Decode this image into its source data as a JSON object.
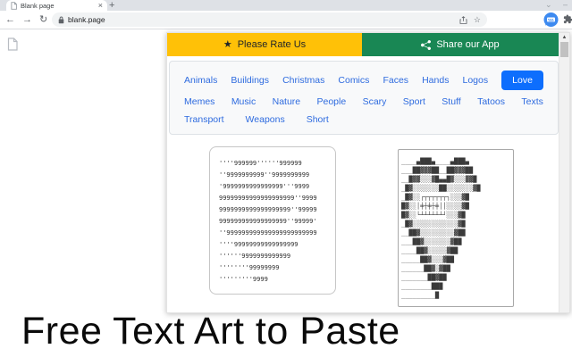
{
  "browser": {
    "tab": {
      "title": "Blank page",
      "close_icon": "×"
    },
    "new_tab_icon": "+",
    "window_controls": {
      "chevron_icon": "⌄",
      "minimize_icon": "–"
    },
    "nav": {
      "back_icon": "←",
      "forward_icon": "→",
      "reload_icon": "↻"
    },
    "omnibox": {
      "url": "blank.page"
    },
    "bookmark_icon": "☆"
  },
  "page": {
    "heading": "Free Text Art to Paste"
  },
  "popup": {
    "banner": {
      "rate_icon": "★",
      "rate_label": "Please Rate Us",
      "share_label": "Share our App"
    },
    "categories": {
      "row1": [
        "Animals",
        "Buildings",
        "Christmas",
        "Comics",
        "Faces",
        "Hands",
        "Logos"
      ],
      "active": "Love",
      "row2": [
        "Memes",
        "Music",
        "Nature",
        "People",
        "Scary",
        "Sport",
        "Stuff",
        "Tatoos",
        "Texts"
      ],
      "row3": [
        "Transport",
        "Weapons",
        "Short"
      ]
    },
    "arts": {
      "heart_nine": "''''999999''''''999999\n''9999999999''9999999999\n'9999999999999999'''9999\n99999999999999999999''9999\n9999999999999999999''99999\n999999999999999999''99999'\n''999999999999999999999999\n''''99999999999999999\n''''''9999999999999\n''''''''99999999\n'''''''''9999",
      "heart_block": "____▄███▄____▄███▄\n___██▓▓▓██__██▓▓▓██\n__█▓▓░░░▓█▄▄█▓░░░▓▓█\n_█▓░░░░░░░██░░░░░░░▓█\n_█▓░░┌┬┬┬┬┬┬┐░░░▓█\n█▓░░│╪┼╪┼╪││░░░░▓█\n█▓░░└┴┴┴┴┴┴┘░░░▓█\n_█▓░░░░░░░░░░░░▓█\n__██▓░░░░░░░░░▓██\n___██▓░░░░░░░▓██\n____██▓░░░░░▓██\n_____██▓░░░▓██\n______██▓░▓██\n_______██▓██\n________███\n_________█"
    },
    "scrollbar": {
      "up_icon": "▲"
    }
  },
  "colors": {
    "rate_yellow": "#ffc107",
    "share_green": "#198754",
    "link_blue": "#2e6bdf",
    "active_blue": "#0d6efd",
    "tabstrip_gray": "#dee1e6",
    "panel_gray": "#f8f9fa"
  }
}
